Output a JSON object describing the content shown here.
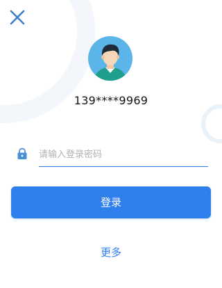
{
  "colors": {
    "accent": "#2f80ed",
    "close_icon": "#3b7fc9",
    "avatar_background": "#5bb5e8",
    "input_underline": "#2f7de1",
    "placeholder": "#b2b2b2",
    "text_primary": "#111111"
  },
  "header": {
    "close_icon": "close-icon"
  },
  "account": {
    "avatar_icon": "user-avatar-icon",
    "masked_phone": "139****9969"
  },
  "password": {
    "icon": "lock-icon",
    "placeholder": "请输入登录密码",
    "value": ""
  },
  "actions": {
    "login_label": "登录",
    "more_label": "更多"
  }
}
